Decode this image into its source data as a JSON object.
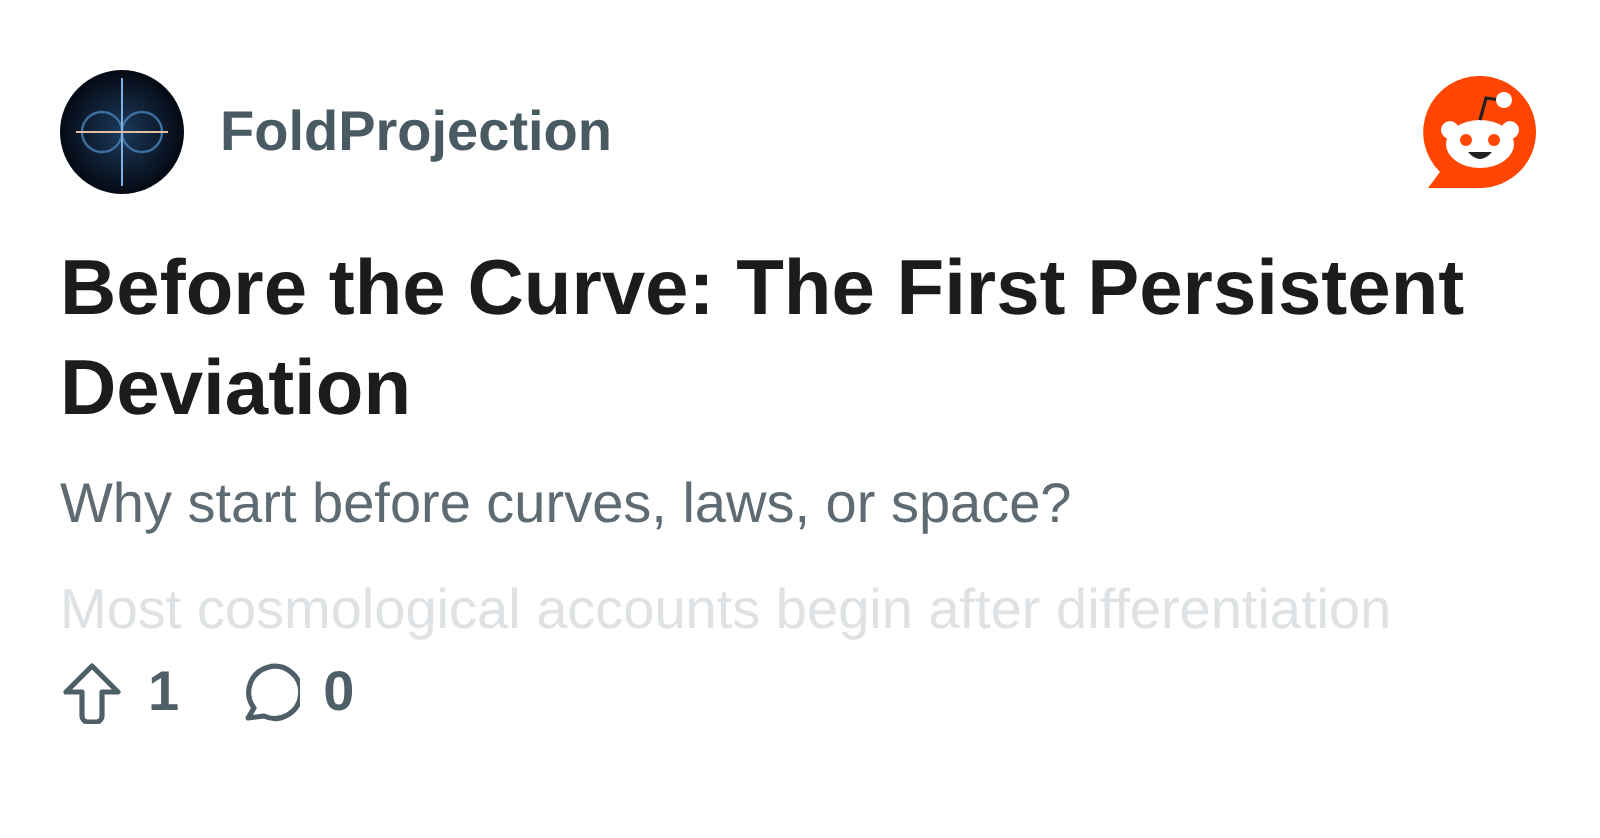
{
  "author": {
    "name": "FoldProjection"
  },
  "post": {
    "title": "Before the Curve: The First Persistent Deviation",
    "subtitle": "Why start before curves, laws, or space?",
    "excerpt": "Most cosmological accounts begin after differentiation"
  },
  "stats": {
    "upvotes": "1",
    "comments": "0"
  }
}
